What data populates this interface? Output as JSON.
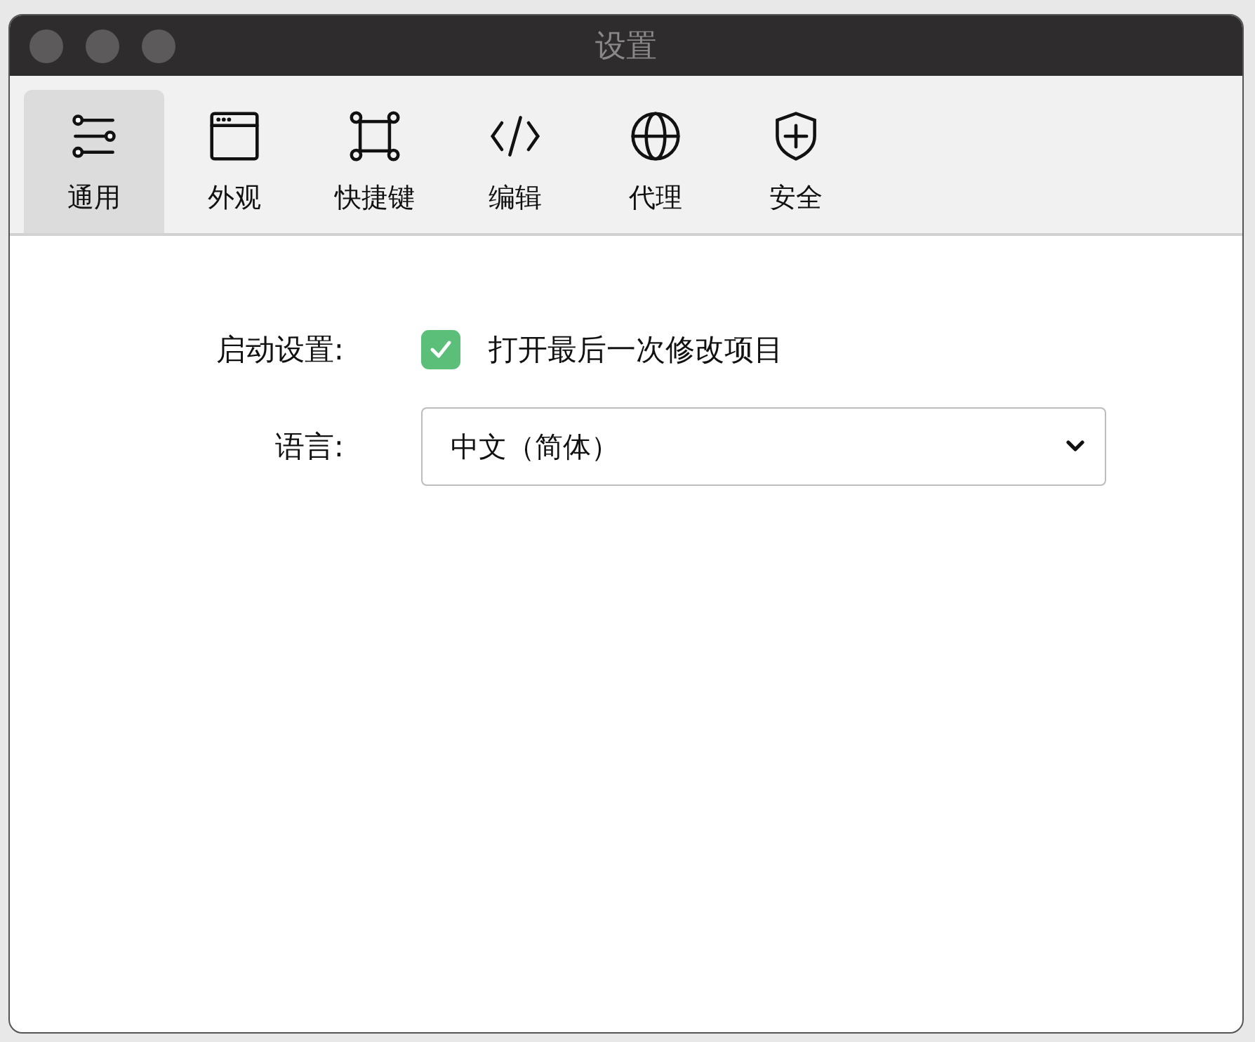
{
  "window": {
    "title": "设置"
  },
  "tabs": [
    {
      "label": "通用",
      "kind": "sliders",
      "selected": true
    },
    {
      "label": "外观",
      "kind": "window",
      "selected": false
    },
    {
      "label": "快捷键",
      "kind": "command",
      "selected": false
    },
    {
      "label": "编辑",
      "kind": "code",
      "selected": false
    },
    {
      "label": "代理",
      "kind": "globe",
      "selected": false
    },
    {
      "label": "安全",
      "kind": "shield",
      "selected": false
    }
  ],
  "startup": {
    "label": "启动设置:",
    "checked": true,
    "option": "打开最后一次修改项目"
  },
  "language": {
    "label": "语言:",
    "value": "中文（简体）"
  }
}
